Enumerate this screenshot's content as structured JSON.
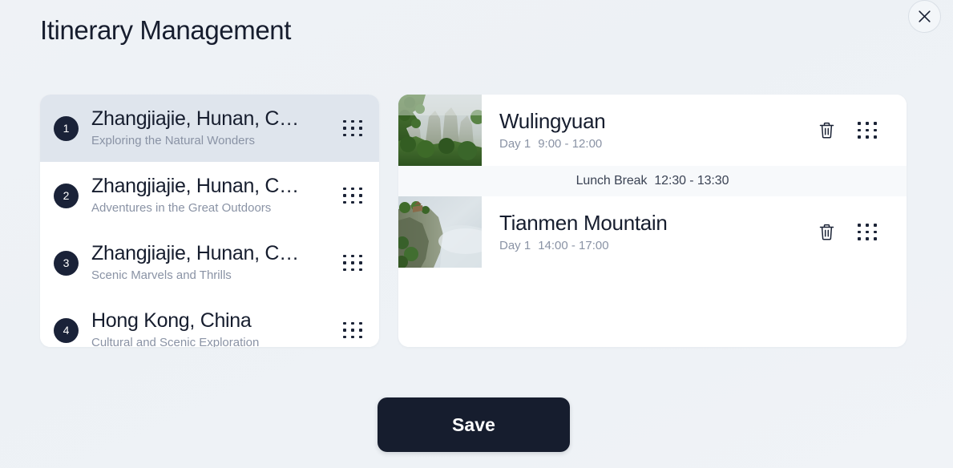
{
  "header": {
    "title": "Itinerary Management",
    "close_label": "×"
  },
  "itinerary_list": [
    {
      "number": "1",
      "title": "Zhangjiajie, Hunan, C…",
      "subtitle": "Exploring the Natural Wonders",
      "selected": true
    },
    {
      "number": "2",
      "title": "Zhangjiajie, Hunan, C…",
      "subtitle": "Adventures in the Great Outdoors",
      "selected": false
    },
    {
      "number": "3",
      "title": "Zhangjiajie, Hunan, C…",
      "subtitle": "Scenic Marvels and Thrills",
      "selected": false
    },
    {
      "number": "4",
      "title": "Hong Kong, China",
      "subtitle": "Cultural and Scenic Exploration",
      "selected": false
    }
  ],
  "schedule": [
    {
      "kind": "activity",
      "title": "Wulingyuan",
      "day": "Day 1",
      "time": "9:00 - 12:00",
      "thumbnail": "misty-green-mountain-photo"
    },
    {
      "kind": "break",
      "label": "Lunch Break",
      "time": "12:30 - 13:30"
    },
    {
      "kind": "activity",
      "title": "Tianmen Mountain",
      "day": "Day 1",
      "time": "14:00 - 17:00",
      "thumbnail": "cliff-in-mist-photo"
    }
  ],
  "footer": {
    "save_label": "Save"
  },
  "colors": {
    "background": "#eef2f6",
    "panel": "#ffffff",
    "selected_item": "#dfe5ed",
    "break_row": "#f7f9fb",
    "text_primary": "#161d2e",
    "text_muted": "#8a93a5",
    "badge": "#1a2238",
    "save_button": "#161d2e"
  }
}
